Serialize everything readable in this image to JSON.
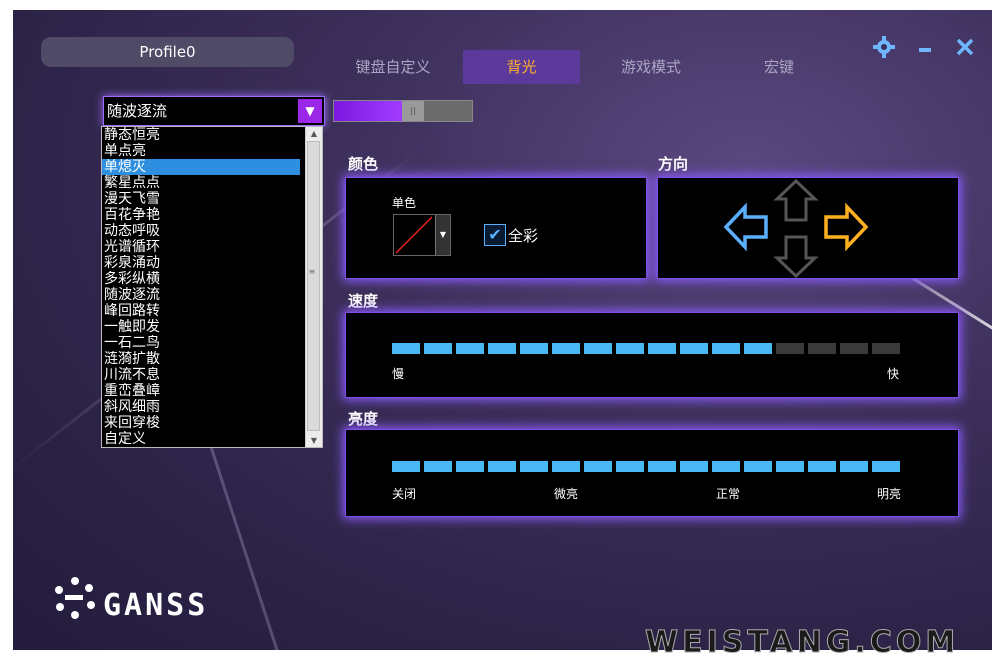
{
  "profile": {
    "name": "Profile0"
  },
  "tabs": [
    {
      "label": "键盘自定义",
      "active": false
    },
    {
      "label": "背光",
      "active": true
    },
    {
      "label": "游戏模式",
      "active": false
    },
    {
      "label": "宏键",
      "active": false
    }
  ],
  "window_controls": {
    "settings": "settings-icon",
    "minimize": "minimize-icon",
    "close": "close-icon"
  },
  "mode_select": {
    "value": "随波逐流",
    "options": [
      "静态恒亮",
      "单点亮",
      "单熄灭",
      "繁星点点",
      "漫天飞雪",
      "百花争艳",
      "动态呼吸",
      "光谱循环",
      "彩泉涌动",
      "多彩纵横",
      "随波逐流",
      "峰回路转",
      "一触即发",
      "一石二鸟",
      "涟漪扩散",
      "川流不息",
      "重峦叠嶂",
      "斜风细雨",
      "来回穿梭",
      "自定义"
    ],
    "highlighted": "单熄灭"
  },
  "backlight_toggle": {
    "state": "on"
  },
  "color": {
    "label": "颜色",
    "mode_title": "单色",
    "full_color_label": "全彩",
    "full_color_checked": true
  },
  "direction": {
    "label": "方向",
    "selected": "right"
  },
  "speed": {
    "label": "速度",
    "level": 12,
    "max": 16,
    "min_label": "慢",
    "max_label": "快"
  },
  "brightness": {
    "label": "亮度",
    "level": 16,
    "max": 16,
    "marks": [
      "关闭",
      "微亮",
      "正常",
      "明亮"
    ]
  },
  "logo": {
    "text": "GANSS"
  },
  "watermark": {
    "text": "WEISTANG.COM"
  },
  "colors": {
    "accent": "#9b28e8",
    "bar_on": "#4ab8f4",
    "tab_active": "#ffb130",
    "arrow_left": "#5ab0ff",
    "arrow_right": "#ffb020"
  }
}
